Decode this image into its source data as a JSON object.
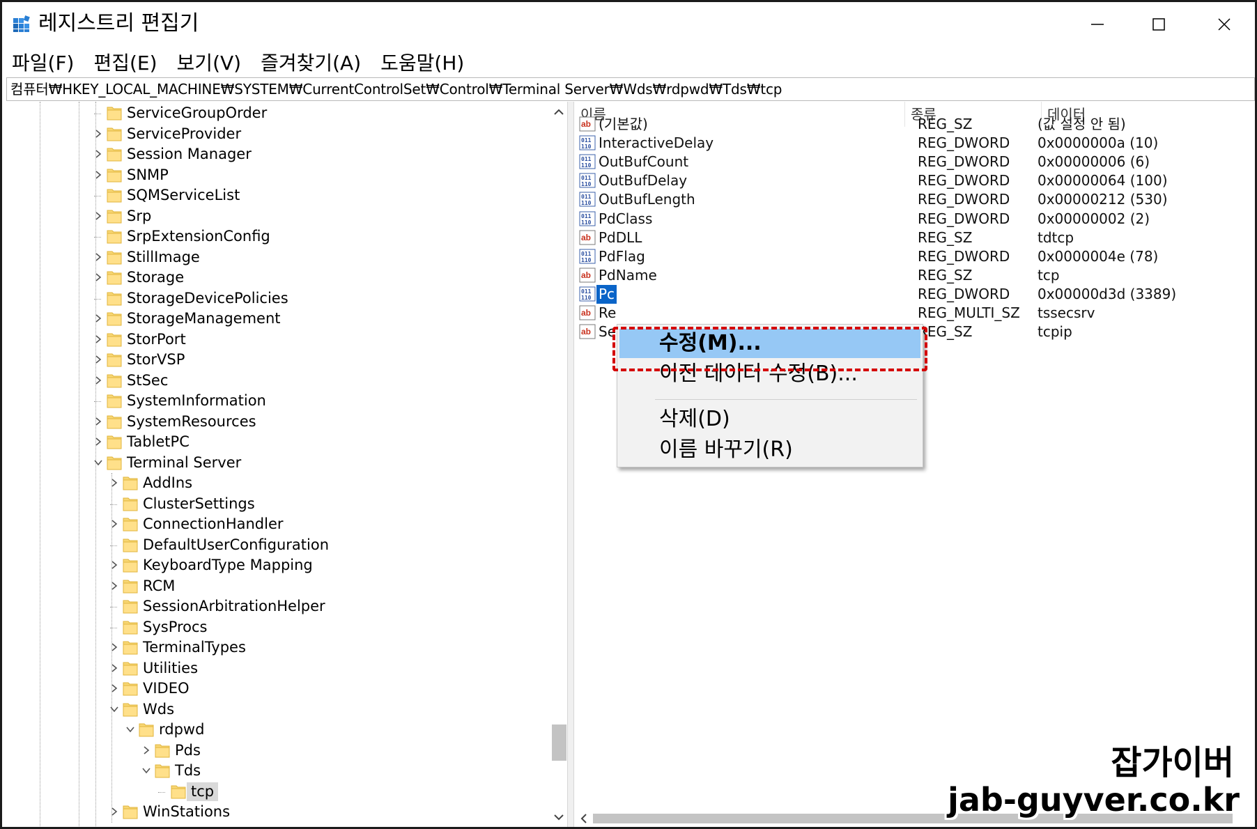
{
  "window": {
    "title": "레지스트리 편집기"
  },
  "menu": [
    "파일(F)",
    "편집(E)",
    "보기(V)",
    "즐겨찾기(A)",
    "도움말(H)"
  ],
  "address": "컴퓨터₩HKEY_LOCAL_MACHINE₩SYSTEM₩CurrentControlSet₩Control₩Terminal Server₩Wds₩rdpwd₩Tds₩tcp",
  "tree": [
    {
      "label": "ServiceGroupOrder",
      "level": 1,
      "expander": "none"
    },
    {
      "label": "ServiceProvider",
      "level": 1,
      "expander": "collapsed"
    },
    {
      "label": "Session Manager",
      "level": 1,
      "expander": "collapsed"
    },
    {
      "label": "SNMP",
      "level": 1,
      "expander": "collapsed"
    },
    {
      "label": "SQMServiceList",
      "level": 1,
      "expander": "none"
    },
    {
      "label": "Srp",
      "level": 1,
      "expander": "collapsed"
    },
    {
      "label": "SrpExtensionConfig",
      "level": 1,
      "expander": "none"
    },
    {
      "label": "StillImage",
      "level": 1,
      "expander": "collapsed"
    },
    {
      "label": "Storage",
      "level": 1,
      "expander": "collapsed"
    },
    {
      "label": "StorageDevicePolicies",
      "level": 1,
      "expander": "none"
    },
    {
      "label": "StorageManagement",
      "level": 1,
      "expander": "collapsed"
    },
    {
      "label": "StorPort",
      "level": 1,
      "expander": "collapsed"
    },
    {
      "label": "StorVSP",
      "level": 1,
      "expander": "collapsed"
    },
    {
      "label": "StSec",
      "level": 1,
      "expander": "collapsed"
    },
    {
      "label": "SystemInformation",
      "level": 1,
      "expander": "none"
    },
    {
      "label": "SystemResources",
      "level": 1,
      "expander": "collapsed"
    },
    {
      "label": "TabletPC",
      "level": 1,
      "expander": "collapsed"
    },
    {
      "label": "Terminal Server",
      "level": 1,
      "expander": "expanded"
    },
    {
      "label": "AddIns",
      "level": 2,
      "expander": "collapsed"
    },
    {
      "label": "ClusterSettings",
      "level": 2,
      "expander": "none"
    },
    {
      "label": "ConnectionHandler",
      "level": 2,
      "expander": "collapsed"
    },
    {
      "label": "DefaultUserConfiguration",
      "level": 2,
      "expander": "none"
    },
    {
      "label": "KeyboardType Mapping",
      "level": 2,
      "expander": "collapsed"
    },
    {
      "label": "RCM",
      "level": 2,
      "expander": "collapsed"
    },
    {
      "label": "SessionArbitrationHelper",
      "level": 2,
      "expander": "none"
    },
    {
      "label": "SysProcs",
      "level": 2,
      "expander": "none"
    },
    {
      "label": "TerminalTypes",
      "level": 2,
      "expander": "collapsed"
    },
    {
      "label": "Utilities",
      "level": 2,
      "expander": "collapsed"
    },
    {
      "label": "VIDEO",
      "level": 2,
      "expander": "collapsed"
    },
    {
      "label": "Wds",
      "level": 2,
      "expander": "expanded"
    },
    {
      "label": "rdpwd",
      "level": 3,
      "expander": "expanded"
    },
    {
      "label": "Pds",
      "level": 4,
      "expander": "collapsed"
    },
    {
      "label": "Tds",
      "level": 4,
      "expander": "expanded"
    },
    {
      "label": "tcp",
      "level": 5,
      "expander": "none",
      "selected": true
    },
    {
      "label": "WinStations",
      "level": 2,
      "expander": "collapsed"
    }
  ],
  "list": {
    "columns": [
      "이름",
      "종류",
      "데이터"
    ],
    "rows": [
      {
        "icon": "string-value-icon",
        "name": "(기본값)",
        "type": "REG_SZ",
        "data": "(값 설정 안 됨)"
      },
      {
        "icon": "binary-value-icon",
        "name": "InteractiveDelay",
        "type": "REG_DWORD",
        "data": "0x0000000a (10)"
      },
      {
        "icon": "binary-value-icon",
        "name": "OutBufCount",
        "type": "REG_DWORD",
        "data": "0x00000006 (6)"
      },
      {
        "icon": "binary-value-icon",
        "name": "OutBufDelay",
        "type": "REG_DWORD",
        "data": "0x00000064 (100)"
      },
      {
        "icon": "binary-value-icon",
        "name": "OutBufLength",
        "type": "REG_DWORD",
        "data": "0x00000212 (530)"
      },
      {
        "icon": "binary-value-icon",
        "name": "PdClass",
        "type": "REG_DWORD",
        "data": "0x00000002 (2)"
      },
      {
        "icon": "string-value-icon",
        "name": "PdDLL",
        "type": "REG_SZ",
        "data": "tdtcp"
      },
      {
        "icon": "binary-value-icon",
        "name": "PdFlag",
        "type": "REG_DWORD",
        "data": "0x0000004e (78)"
      },
      {
        "icon": "string-value-icon",
        "name": "PdName",
        "type": "REG_SZ",
        "data": "tcp"
      },
      {
        "icon": "binary-value-icon",
        "name": "Pc",
        "type": "REG_DWORD",
        "data": "0x00000d3d (3389)",
        "selected": true
      },
      {
        "icon": "string-value-icon",
        "name": "Re",
        "type": "REG_MULTI_SZ",
        "data": "tssecsrv"
      },
      {
        "icon": "string-value-icon",
        "name": "Se",
        "type": "REG_SZ",
        "data": "tcpip"
      }
    ]
  },
  "context_menu": {
    "items": [
      "수정(M)...",
      "이진 데이터 수정(B)...",
      "삭제(D)",
      "이름 바꾸기(R)"
    ]
  },
  "watermark": {
    "line1": "잡가이버",
    "line2": "jab-guyver.co.kr"
  }
}
